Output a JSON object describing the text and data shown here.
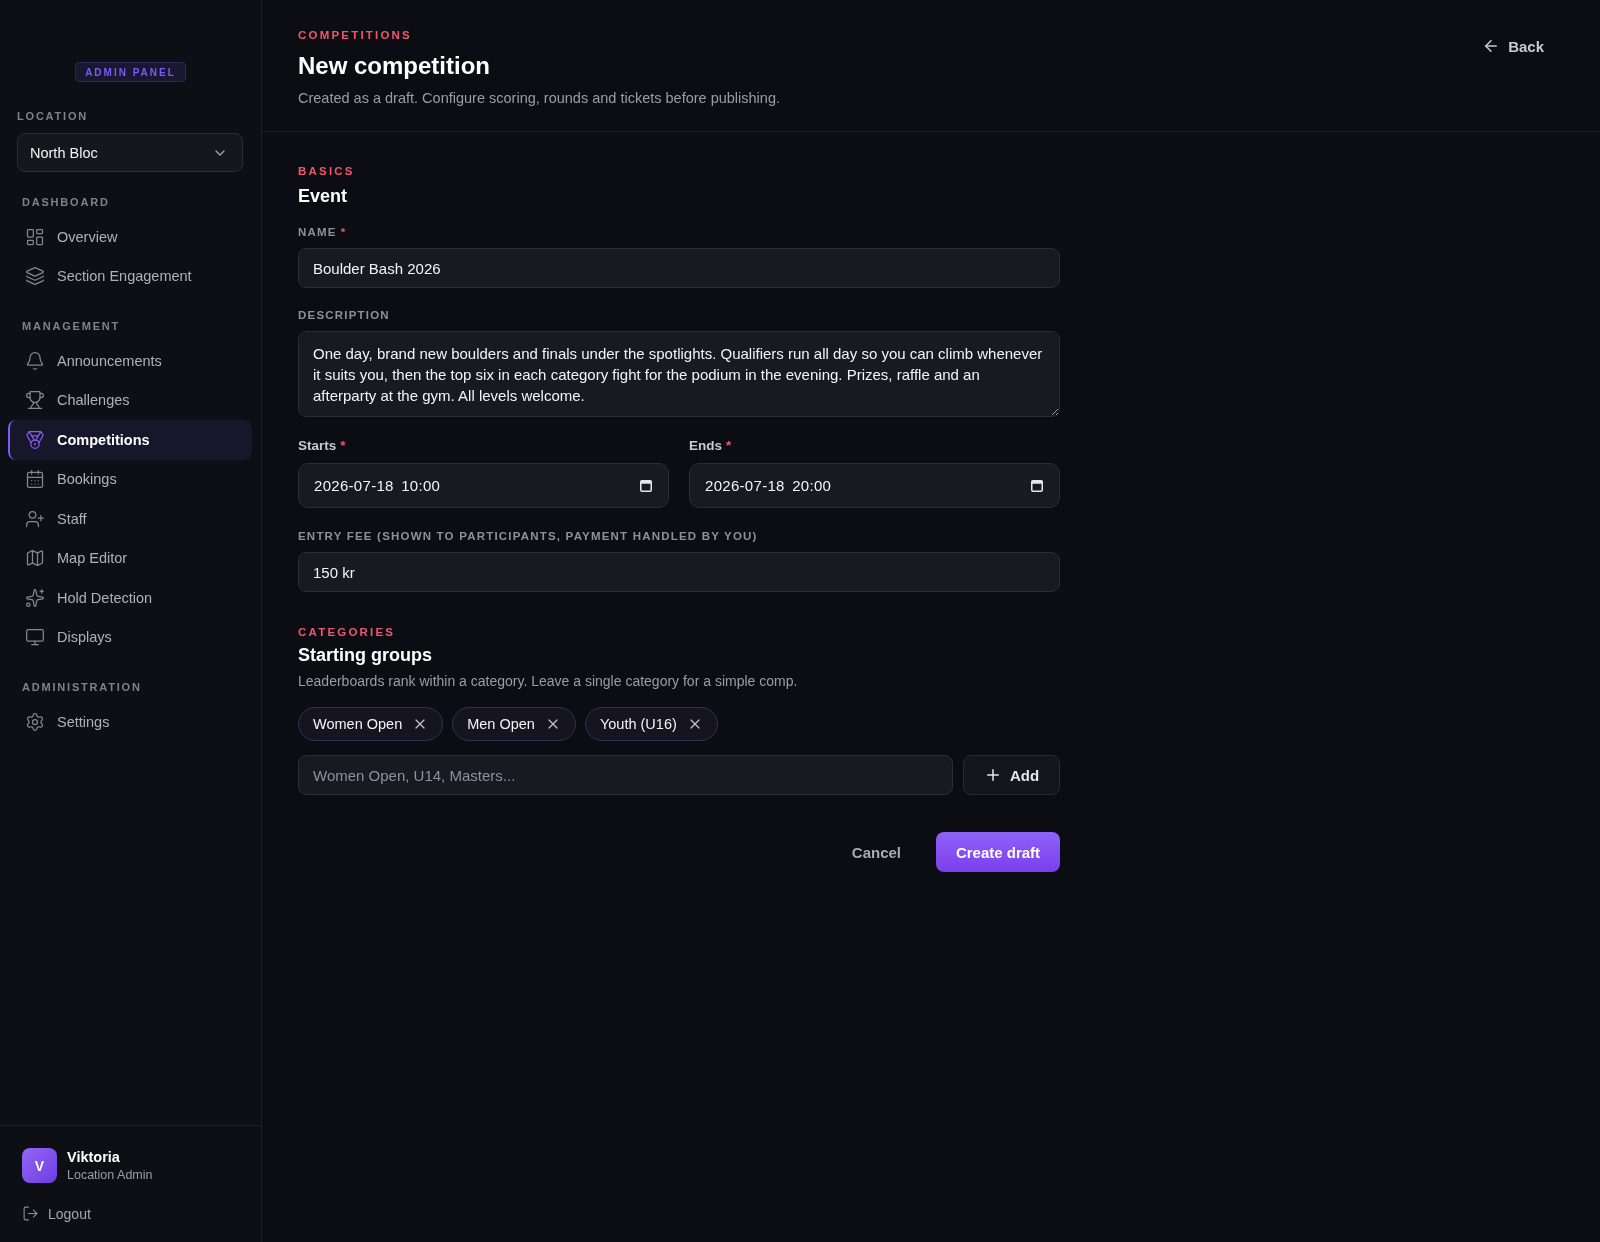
{
  "sidebar": {
    "badge": "ADMIN PANEL",
    "location": {
      "label": "LOCATION",
      "value": "North Bloc"
    },
    "sections": [
      {
        "title": "DASHBOARD",
        "items": [
          {
            "label": "Overview",
            "selected": false
          },
          {
            "label": "Section Engagement",
            "selected": false
          }
        ]
      },
      {
        "title": "MANAGEMENT",
        "items": [
          {
            "label": "Announcements",
            "selected": false
          },
          {
            "label": "Challenges",
            "selected": false
          },
          {
            "label": "Competitions",
            "selected": true
          },
          {
            "label": "Bookings",
            "selected": false
          },
          {
            "label": "Staff",
            "selected": false
          },
          {
            "label": "Map Editor",
            "selected": false
          },
          {
            "label": "Hold Detection",
            "selected": false
          },
          {
            "label": "Displays",
            "selected": false
          }
        ]
      },
      {
        "title": "ADMINISTRATION",
        "items": [
          {
            "label": "Settings",
            "selected": false
          }
        ]
      }
    ],
    "user": {
      "initial": "V",
      "name": "Viktoria",
      "role": "Location Admin"
    },
    "logout": "Logout"
  },
  "header": {
    "eyebrow": "COMPETITIONS",
    "title": "New competition",
    "subtitle": "Created as a draft. Configure scoring, rounds and tickets before publishing.",
    "back": "Back"
  },
  "basics": {
    "eyebrow": "BASICS",
    "title": "Event",
    "name": {
      "label": "NAME",
      "required_mark": "*",
      "value": "Boulder Bash 2026"
    },
    "description": {
      "label": "DESCRIPTION",
      "value": "One day, brand new boulders and finals under the spotlights. Qualifiers run all day so you can climb whenever it suits you, then the top six in each category fight for the podium in the evening. Prizes, raffle and an afterparty at the gym. All levels welcome."
    },
    "schedule": [
      {
        "label": "Starts",
        "required_mark": "*",
        "value": "2026-07-18 10:00"
      },
      {
        "label": "Ends",
        "required_mark": "*",
        "value": "2026-07-18 20:00"
      }
    ],
    "entry_fee": {
      "label": "ENTRY FEE (SHOWN TO PARTICIPANTS, PAYMENT HANDLED BY YOU)",
      "value": "150 kr"
    }
  },
  "categories": {
    "eyebrow": "CATEGORIES",
    "title": "Starting groups",
    "description": "Leaderboards rank within a category. Leave a single category for a simple comp.",
    "tags": [
      "Women Open",
      "Men Open",
      "Youth (U16)"
    ],
    "input": {
      "placeholder": "Women Open, U14, Masters..."
    },
    "add": "Add"
  },
  "actions": {
    "cancel": "Cancel",
    "submit": "Create draft"
  }
}
